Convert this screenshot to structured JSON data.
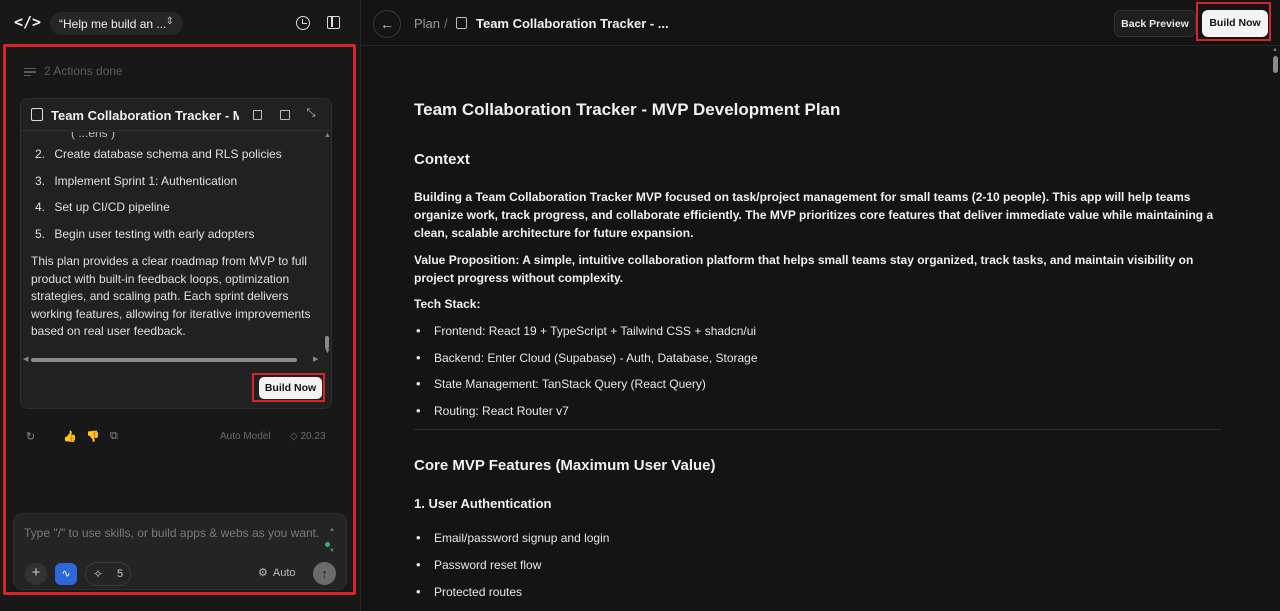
{
  "left_panel": {
    "prompt_title": "“Help me build an ...",
    "actions_done": "2 Actions done",
    "plan_card": {
      "title": "Team Collaboration Tracker - MV...",
      "cutoff_text": "( ...ens )",
      "steps": [
        {
          "n": "2.",
          "text": "Create database schema and RLS policies"
        },
        {
          "n": "3.",
          "text": "Implement Sprint 1: Authentication"
        },
        {
          "n": "4.",
          "text": "Set up CI/CD pipeline"
        },
        {
          "n": "5.",
          "text": "Begin user testing with early adopters"
        }
      ],
      "summary": "This plan provides a clear roadmap from MVP to full product with built-in feedback loops, optimization strategies, and scaling path. Each sprint delivers working features, allowing for iterative improvements based on real user feedback.",
      "build_button": "Build Now"
    },
    "message_meta": {
      "model": "Auto Model",
      "credits": "20.23"
    },
    "composer": {
      "placeholder": "Type \"/\" to use skills, or build apps & webs as you want...",
      "skills_count": "5",
      "mode": "Auto"
    }
  },
  "right_panel": {
    "breadcrumb": {
      "root": "Plan",
      "separator": "/",
      "current": "Team Collaboration Tracker - ..."
    },
    "back_preview": "Back Preview",
    "build_now": "Build Now",
    "doc": {
      "title": "Team Collaboration Tracker - MVP Development Plan",
      "context_heading": "Context",
      "context_para": "Building a Team Collaboration Tracker MVP focused on task/project management for small teams (2-10 people). This app will help teams organize work, track progress, and collaborate efficiently. The MVP prioritizes core features that deliver immediate value while maintaining a clean, scalable architecture for future expansion.",
      "value_prop": "Value Proposition: A simple, intuitive collaboration platform that helps small teams stay organized, track tasks, and maintain visibility on project progress without complexity.",
      "tech_stack_label": "Tech Stack:",
      "tech_stack": [
        "Frontend: React 19 + TypeScript + Tailwind CSS + shadcn/ui",
        "Backend: Enter Cloud (Supabase) - Auth, Database, Storage",
        "State Management: TanStack Query (React Query)",
        "Routing: React Router v7"
      ],
      "features_heading": "Core MVP Features (Maximum User Value)",
      "auth_heading": "1. User Authentication",
      "auth_items": [
        "Email/password signup and login",
        "Password reset flow",
        "Protected routes"
      ]
    }
  }
}
